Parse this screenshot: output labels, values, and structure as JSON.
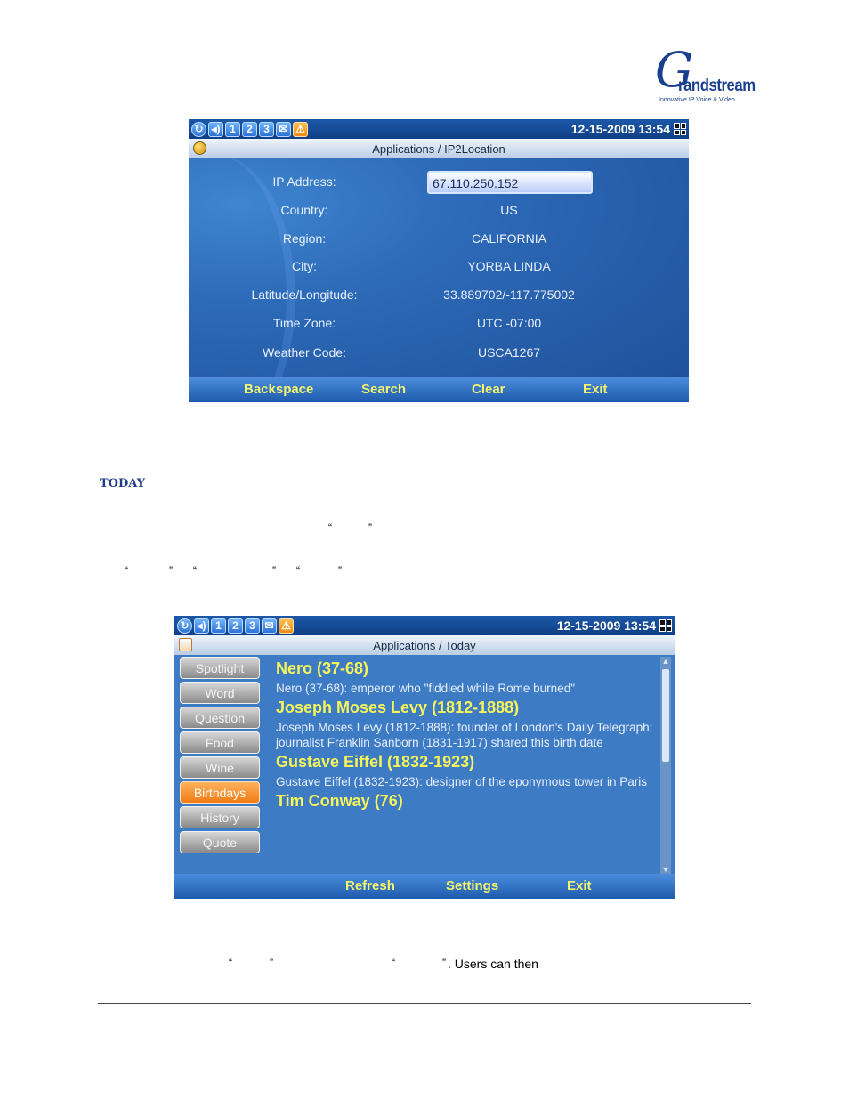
{
  "logo": {
    "letter": "G",
    "word": "randstream",
    "tagline": "Innovative IP Voice & Video"
  },
  "statusbar": {
    "icons": [
      "refresh-icon",
      "speaker-icon",
      "1",
      "2",
      "3",
      "message-icon",
      "alert-icon"
    ],
    "datetime": "12-15-2009 13:54"
  },
  "ip2location": {
    "title": "Applications / IP2Location",
    "fields": [
      {
        "label": "IP Address:",
        "value": "67.110.250.152"
      },
      {
        "label": "Country:",
        "value": "US"
      },
      {
        "label": "Region:",
        "value": "CALIFORNIA"
      },
      {
        "label": "City:",
        "value": "YORBA LINDA"
      },
      {
        "label": "Latitude/Longitude:",
        "value": "33.889702/-117.775002"
      },
      {
        "label": "Time Zone:",
        "value": "UTC -07:00"
      },
      {
        "label": "Weather Code:",
        "value": "USCA1267"
      }
    ],
    "softkeys": [
      "Backspace",
      "Search",
      "Clear",
      "Exit"
    ]
  },
  "doc": {
    "heading": "TODAY",
    "quote_open": "“",
    "quote_close": "”",
    "bottom_fragment": ". Users can then"
  },
  "today": {
    "title": "Applications / Today",
    "side_menu": [
      "Spotlight",
      "Word",
      "Question",
      "Food",
      "Wine",
      "Birthdays",
      "History",
      "Quote"
    ],
    "active_item": "Birthdays",
    "entries": [
      {
        "name": "Nero (37-68)",
        "desc": "Nero (37-68): emperor who \"fiddled while Rome burned\""
      },
      {
        "name": "Joseph Moses Levy (1812-1888)",
        "desc": "Joseph Moses Levy (1812-1888): founder of London's Daily Telegraph; journalist Franklin Sanborn (1831-1917) shared this birth date"
      },
      {
        "name": "Gustave Eiffel (1832-1923)",
        "desc": "Gustave Eiffel (1832-1923): designer of the eponymous tower in Paris"
      },
      {
        "name": "Tim Conway (76)",
        "desc": ""
      }
    ],
    "softkeys": [
      "Refresh",
      "Settings",
      "Exit"
    ]
  }
}
